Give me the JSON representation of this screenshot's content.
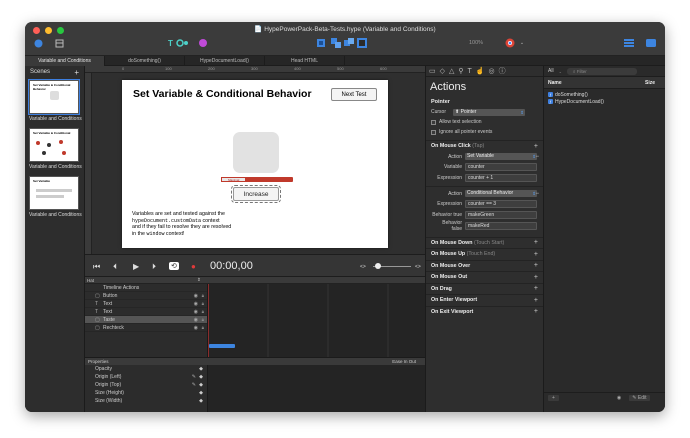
{
  "window": {
    "title": "HypePowerPack-Beta-Tests.hype (Variable and Conditions)"
  },
  "toolbar": {
    "zoom": "100%",
    "doc_icon": "📄"
  },
  "tabs": [
    {
      "label": "Variable and Conditions",
      "active": true
    },
    {
      "label": "doSomething()"
    },
    {
      "label": "HypeDocumentLoad()"
    },
    {
      "label": "Head HTML"
    }
  ],
  "scenes": {
    "title": "Scenes",
    "items": [
      {
        "name": "Variable and Conditions",
        "thumb": "Set Variable & Conditional Behavior"
      },
      {
        "name": "Variable and Conditions",
        "thumb": "Set Variable & Conditional"
      },
      {
        "name": "Variable and Conditions",
        "thumb": "Set Variable"
      }
    ]
  },
  "ruler": {
    "ticks": [
      "0",
      "100",
      "200",
      "300",
      "400",
      "500",
      "600"
    ]
  },
  "stage": {
    "heading": "Set Variable & Conditional Behavior",
    "next_button": "Next Test",
    "meter": [
      "Maximal",
      "",
      ""
    ],
    "increase_button": "Increase",
    "desc1": "Variables are set and tested against the",
    "desc2_code": "hypeDocument.customData",
    "desc2_text": " context",
    "desc3": "and if they fail to resolve they are resolved",
    "desc4_pre": "in the ",
    "desc4_code": "window",
    "desc4_post": " context!"
  },
  "playback": {
    "time": "00:00,00"
  },
  "timeline": {
    "selector": "Hat",
    "rows": [
      {
        "label": "Timeline Actions",
        "icon": "",
        "selected": false
      },
      {
        "label": "Button",
        "icon": "▢",
        "selected": false
      },
      {
        "label": "Text",
        "icon": "T",
        "selected": false
      },
      {
        "label": "Text",
        "icon": "T",
        "selected": false
      },
      {
        "label": "Taste",
        "icon": "▢",
        "selected": true
      },
      {
        "label": "Rechteck",
        "icon": "▢",
        "selected": false
      }
    ]
  },
  "properties": {
    "header": "Properties",
    "ease": "Ease In Out",
    "rows": [
      "Opacity",
      "Origin (Left)",
      "Origin (Top)",
      "Size (Height)",
      "Size (Width)"
    ]
  },
  "inspector": {
    "title": "Actions",
    "pointer_section": "Pointer",
    "cursor_label": "Cursor",
    "cursor_value": "Pointer",
    "allow_text": "Allow text selection",
    "ignore_pointer": "Ignore all pointer events",
    "mouse_click": "On Mouse Click",
    "mouse_click_sub": "(Tap)",
    "action_label": "Action",
    "action1": "Set Variable",
    "variable_label": "Variable",
    "variable_value": "counter",
    "expression_label": "Expression",
    "expression1": "counter + 1",
    "action2": "Conditional Behavior",
    "expression2": "counter == 3",
    "behavior_true_label": "Behavior true",
    "behavior_true": "makeGreen",
    "behavior_false_label": "Behavior false",
    "behavior_false": "makeRed",
    "sections": [
      {
        "label": "On Mouse Down",
        "sub": "(Touch Start)"
      },
      {
        "label": "On Mouse Up",
        "sub": "(Touch End)"
      },
      {
        "label": "On Mouse Over",
        "sub": ""
      },
      {
        "label": "On Mouse Out",
        "sub": ""
      },
      {
        "label": "On Drag",
        "sub": ""
      },
      {
        "label": "On Enter Viewport",
        "sub": ""
      },
      {
        "label": "On Exit Viewport",
        "sub": ""
      }
    ]
  },
  "functions": {
    "filter_scope": "All",
    "filter_placeholder": "Filter",
    "col_name": "Name",
    "col_size": "Size",
    "items": [
      "doSomething()",
      "HypeDocumentLoad()"
    ],
    "edit_label": "Edit"
  },
  "colors": {
    "accent": "#3d85e0",
    "meter_red": "#c0392b"
  }
}
